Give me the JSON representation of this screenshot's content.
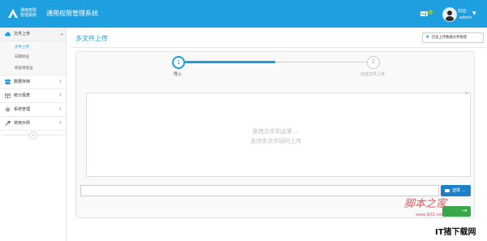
{
  "header": {
    "logo_line1": "通用权限",
    "logo_line2": "管理系统",
    "title": "通用权限管理系统",
    "user_greeting": "欢迎,",
    "user_name": "admin",
    "brand_color": "#1e9fe0"
  },
  "sidebar": {
    "items": [
      {
        "label": "文件上传",
        "icon": "cloud-upload-icon",
        "expanded": true
      },
      {
        "label": "数据存档",
        "icon": "archive-icon"
      },
      {
        "label": "统计报表",
        "icon": "table-icon"
      },
      {
        "label": "系统管理",
        "icon": "gear-icon"
      },
      {
        "label": "常用示例",
        "icon": "wrench-icon"
      }
    ],
    "subitems": [
      {
        "label": "文件上传",
        "active": true
      },
      {
        "label": "日期验证"
      },
      {
        "label": "校验单验证"
      }
    ]
  },
  "page": {
    "title": "多文件上传",
    "history_button": "历史上传数据文件管理"
  },
  "steps": [
    {
      "number": "1",
      "label": "导入",
      "state": "active"
    },
    {
      "number": "2",
      "label": "完成文件上传",
      "state": "todo"
    }
  ],
  "step_progress": 0.5,
  "upload": {
    "dropzone_line1": "拖拽文件到这里 ...",
    "dropzone_line2": "支持多文件同时上传",
    "browse_button": "选择 ...",
    "next_arrow": "→"
  },
  "watermarks": {
    "jb51_text": "脚本之家",
    "jb51_url": "www.jb51.net",
    "bottom_text": "IT猪下载网"
  }
}
